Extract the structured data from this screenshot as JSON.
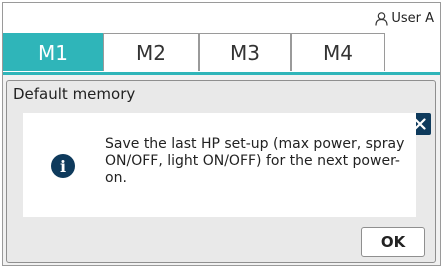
{
  "user": {
    "name": "User A",
    "icon": "user-icon"
  },
  "tabs": [
    {
      "label": "M1",
      "active": true
    },
    {
      "label": "M2",
      "active": false
    },
    {
      "label": "M3",
      "active": false
    },
    {
      "label": "M4",
      "active": false
    }
  ],
  "dialog": {
    "title": "Default memory",
    "close_icon": "close-icon",
    "info_icon": "info-icon",
    "info_glyph": "i",
    "message": "Save the last HP set-up (max power, spray ON/OFF, light ON/OFF) for the next power-on.",
    "ok_label": "OK"
  },
  "colors": {
    "accent": "#2fb5b9",
    "dark_icon": "#0e3a5c"
  }
}
